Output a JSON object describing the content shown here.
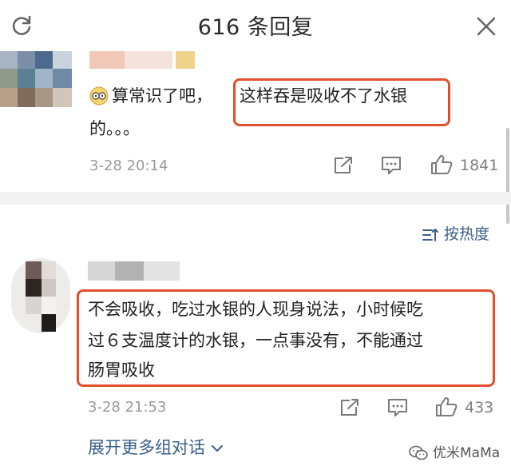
{
  "header": {
    "title": "616 条回复"
  },
  "comment1": {
    "line1_prefix": "算常识了吧，",
    "line1_highlight": "这样吞是吸收不了水银",
    "line2": "的。。。",
    "date": "3-28 20:14",
    "likes": "1841"
  },
  "sort": {
    "label": "按热度"
  },
  "comment2": {
    "line1": "不会吸收，吃过水银的人现身说法，小时候吃",
    "line2": "过６支温度计的水银，一点事没有，不能通过",
    "line3": "肠胃吸收",
    "date": "3-28 21:53",
    "likes": "433",
    "expand": "展开更多组对话"
  },
  "watermark": {
    "text": "优米MaMa"
  },
  "colors": {
    "highlight_border": "#e0502c",
    "link": "#3a5f8a",
    "meta": "#9a9a9a"
  }
}
